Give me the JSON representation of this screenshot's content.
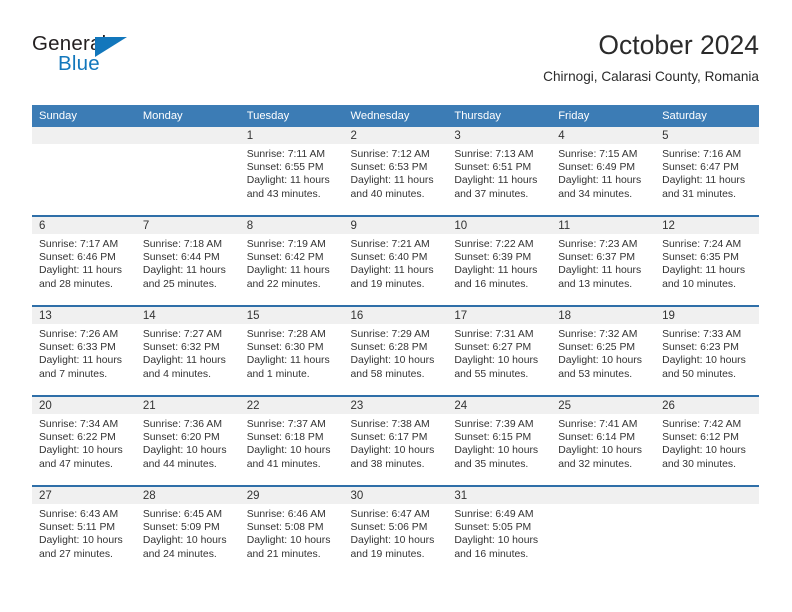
{
  "brand": {
    "name_part1": "General",
    "name_part2": "Blue",
    "logo_icon": "triangle-logo-icon"
  },
  "header": {
    "title": "October 2024",
    "subtitle": "Chirnogi, Calarasi County, Romania"
  },
  "colors": {
    "header_blue": "#3c7cb5",
    "row_divider_blue": "#2f6fa8",
    "daynum_band_gray": "#f0f0f0",
    "brand_blue": "#1277bc",
    "text": "#333333"
  },
  "weekday_headers": [
    "Sunday",
    "Monday",
    "Tuesday",
    "Wednesday",
    "Thursday",
    "Friday",
    "Saturday"
  ],
  "weeks": [
    [
      {
        "day": "",
        "empty": true,
        "sunrise": "",
        "sunset": "",
        "daylight_line1": "",
        "daylight_line2": ""
      },
      {
        "day": "",
        "empty": true,
        "sunrise": "",
        "sunset": "",
        "daylight_line1": "",
        "daylight_line2": ""
      },
      {
        "day": "1",
        "sunrise": "Sunrise: 7:11 AM",
        "sunset": "Sunset: 6:55 PM",
        "daylight_line1": "Daylight: 11 hours",
        "daylight_line2": "and 43 minutes."
      },
      {
        "day": "2",
        "sunrise": "Sunrise: 7:12 AM",
        "sunset": "Sunset: 6:53 PM",
        "daylight_line1": "Daylight: 11 hours",
        "daylight_line2": "and 40 minutes."
      },
      {
        "day": "3",
        "sunrise": "Sunrise: 7:13 AM",
        "sunset": "Sunset: 6:51 PM",
        "daylight_line1": "Daylight: 11 hours",
        "daylight_line2": "and 37 minutes."
      },
      {
        "day": "4",
        "sunrise": "Sunrise: 7:15 AM",
        "sunset": "Sunset: 6:49 PM",
        "daylight_line1": "Daylight: 11 hours",
        "daylight_line2": "and 34 minutes."
      },
      {
        "day": "5",
        "sunrise": "Sunrise: 7:16 AM",
        "sunset": "Sunset: 6:47 PM",
        "daylight_line1": "Daylight: 11 hours",
        "daylight_line2": "and 31 minutes."
      }
    ],
    [
      {
        "day": "6",
        "sunrise": "Sunrise: 7:17 AM",
        "sunset": "Sunset: 6:46 PM",
        "daylight_line1": "Daylight: 11 hours",
        "daylight_line2": "and 28 minutes."
      },
      {
        "day": "7",
        "sunrise": "Sunrise: 7:18 AM",
        "sunset": "Sunset: 6:44 PM",
        "daylight_line1": "Daylight: 11 hours",
        "daylight_line2": "and 25 minutes."
      },
      {
        "day": "8",
        "sunrise": "Sunrise: 7:19 AM",
        "sunset": "Sunset: 6:42 PM",
        "daylight_line1": "Daylight: 11 hours",
        "daylight_line2": "and 22 minutes."
      },
      {
        "day": "9",
        "sunrise": "Sunrise: 7:21 AM",
        "sunset": "Sunset: 6:40 PM",
        "daylight_line1": "Daylight: 11 hours",
        "daylight_line2": "and 19 minutes."
      },
      {
        "day": "10",
        "sunrise": "Sunrise: 7:22 AM",
        "sunset": "Sunset: 6:39 PM",
        "daylight_line1": "Daylight: 11 hours",
        "daylight_line2": "and 16 minutes."
      },
      {
        "day": "11",
        "sunrise": "Sunrise: 7:23 AM",
        "sunset": "Sunset: 6:37 PM",
        "daylight_line1": "Daylight: 11 hours",
        "daylight_line2": "and 13 minutes."
      },
      {
        "day": "12",
        "sunrise": "Sunrise: 7:24 AM",
        "sunset": "Sunset: 6:35 PM",
        "daylight_line1": "Daylight: 11 hours",
        "daylight_line2": "and 10 minutes."
      }
    ],
    [
      {
        "day": "13",
        "sunrise": "Sunrise: 7:26 AM",
        "sunset": "Sunset: 6:33 PM",
        "daylight_line1": "Daylight: 11 hours",
        "daylight_line2": "and 7 minutes."
      },
      {
        "day": "14",
        "sunrise": "Sunrise: 7:27 AM",
        "sunset": "Sunset: 6:32 PM",
        "daylight_line1": "Daylight: 11 hours",
        "daylight_line2": "and 4 minutes."
      },
      {
        "day": "15",
        "sunrise": "Sunrise: 7:28 AM",
        "sunset": "Sunset: 6:30 PM",
        "daylight_line1": "Daylight: 11 hours",
        "daylight_line2": "and 1 minute."
      },
      {
        "day": "16",
        "sunrise": "Sunrise: 7:29 AM",
        "sunset": "Sunset: 6:28 PM",
        "daylight_line1": "Daylight: 10 hours",
        "daylight_line2": "and 58 minutes."
      },
      {
        "day": "17",
        "sunrise": "Sunrise: 7:31 AM",
        "sunset": "Sunset: 6:27 PM",
        "daylight_line1": "Daylight: 10 hours",
        "daylight_line2": "and 55 minutes."
      },
      {
        "day": "18",
        "sunrise": "Sunrise: 7:32 AM",
        "sunset": "Sunset: 6:25 PM",
        "daylight_line1": "Daylight: 10 hours",
        "daylight_line2": "and 53 minutes."
      },
      {
        "day": "19",
        "sunrise": "Sunrise: 7:33 AM",
        "sunset": "Sunset: 6:23 PM",
        "daylight_line1": "Daylight: 10 hours",
        "daylight_line2": "and 50 minutes."
      }
    ],
    [
      {
        "day": "20",
        "sunrise": "Sunrise: 7:34 AM",
        "sunset": "Sunset: 6:22 PM",
        "daylight_line1": "Daylight: 10 hours",
        "daylight_line2": "and 47 minutes."
      },
      {
        "day": "21",
        "sunrise": "Sunrise: 7:36 AM",
        "sunset": "Sunset: 6:20 PM",
        "daylight_line1": "Daylight: 10 hours",
        "daylight_line2": "and 44 minutes."
      },
      {
        "day": "22",
        "sunrise": "Sunrise: 7:37 AM",
        "sunset": "Sunset: 6:18 PM",
        "daylight_line1": "Daylight: 10 hours",
        "daylight_line2": "and 41 minutes."
      },
      {
        "day": "23",
        "sunrise": "Sunrise: 7:38 AM",
        "sunset": "Sunset: 6:17 PM",
        "daylight_line1": "Daylight: 10 hours",
        "daylight_line2": "and 38 minutes."
      },
      {
        "day": "24",
        "sunrise": "Sunrise: 7:39 AM",
        "sunset": "Sunset: 6:15 PM",
        "daylight_line1": "Daylight: 10 hours",
        "daylight_line2": "and 35 minutes."
      },
      {
        "day": "25",
        "sunrise": "Sunrise: 7:41 AM",
        "sunset": "Sunset: 6:14 PM",
        "daylight_line1": "Daylight: 10 hours",
        "daylight_line2": "and 32 minutes."
      },
      {
        "day": "26",
        "sunrise": "Sunrise: 7:42 AM",
        "sunset": "Sunset: 6:12 PM",
        "daylight_line1": "Daylight: 10 hours",
        "daylight_line2": "and 30 minutes."
      }
    ],
    [
      {
        "day": "27",
        "sunrise": "Sunrise: 6:43 AM",
        "sunset": "Sunset: 5:11 PM",
        "daylight_line1": "Daylight: 10 hours",
        "daylight_line2": "and 27 minutes."
      },
      {
        "day": "28",
        "sunrise": "Sunrise: 6:45 AM",
        "sunset": "Sunset: 5:09 PM",
        "daylight_line1": "Daylight: 10 hours",
        "daylight_line2": "and 24 minutes."
      },
      {
        "day": "29",
        "sunrise": "Sunrise: 6:46 AM",
        "sunset": "Sunset: 5:08 PM",
        "daylight_line1": "Daylight: 10 hours",
        "daylight_line2": "and 21 minutes."
      },
      {
        "day": "30",
        "sunrise": "Sunrise: 6:47 AM",
        "sunset": "Sunset: 5:06 PM",
        "daylight_line1": "Daylight: 10 hours",
        "daylight_line2": "and 19 minutes."
      },
      {
        "day": "31",
        "sunrise": "Sunrise: 6:49 AM",
        "sunset": "Sunset: 5:05 PM",
        "daylight_line1": "Daylight: 10 hours",
        "daylight_line2": "and 16 minutes."
      },
      {
        "day": "",
        "empty": true,
        "sunrise": "",
        "sunset": "",
        "daylight_line1": "",
        "daylight_line2": ""
      },
      {
        "day": "",
        "empty": true,
        "sunrise": "",
        "sunset": "",
        "daylight_line1": "",
        "daylight_line2": ""
      }
    ]
  ]
}
